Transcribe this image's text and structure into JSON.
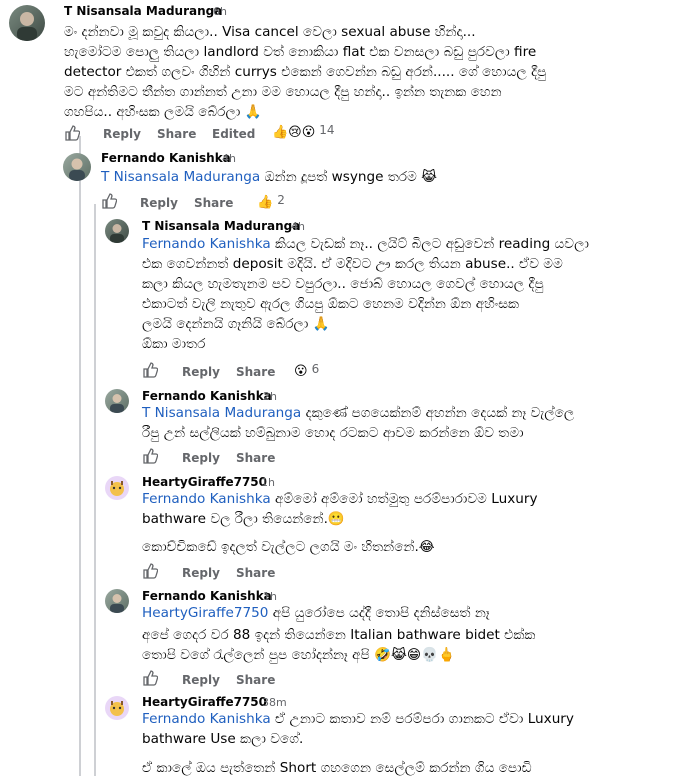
{
  "actions": {
    "reply": "Reply",
    "share": "Share",
    "edited": "Edited"
  },
  "comments": [
    {
      "author": "T Nisansala Maduranga",
      "time": "6h",
      "lines": [
        "මං දන්නවා මූ කවුද කියලා.. Visa cancel වෙලා sexual abuse හින්දා...",
        "හැමෝටම පොලු තියලා landlord වත් නොකියා flat එක වනසලා බඩු පුරවලා fire",
        "detector එකත් ගලවං ගිහින් currys එකෙන් ගෙවන්න බඩු අරන්..... ගේ හොයල දීපු",
        "මට අන්තිමට තීන්ත ගාන්නත් උනා මම හොයල දීපු හන්දා.. ඉන්න තැනක හෙන",
        "ගහපිය.. අහිංසක ලමයි බේරලා 🙏"
      ],
      "reactions": {
        "icons": "👍😢😮",
        "count": "14"
      }
    },
    {
      "author": "Fernando Kanishka",
      "time": "4h",
      "mention": "T Nisansala Maduranga",
      "lines": [
        "ඔන්න දූපත් wsynge තරම 😹"
      ],
      "reactions": {
        "icons": "👍",
        "count": "2"
      }
    },
    {
      "author": "T Nisansala Maduranga",
      "time": "4h",
      "mention": "Fernando Kanishka",
      "lines": [
        "කියල වැඩක් නෑ.. ලයිට් බිලට අඩුවෙන් reading යවලා",
        "එක ගෙවන්නත් deposit මදියි. ඒ මදිවට ඌ කරල තියන abuse.. ඒව මම",
        "කලා කියල හැමතැනම පව වපුරලා.. ජොබ් හොයල ගෙවල් හොයල දීපු",
        "එකාටත් වැලි නැතුව ඇරල ගියපු ඕකට හෙනම වදින්න ඕන අහිංසක",
        "ලමයි දෙන්නයි ගෑනියි බේරලා 🙏",
        "ඕකා මාතර"
      ],
      "reactions": {
        "icons": "😮",
        "count": "6"
      }
    },
    {
      "author": "Fernando Kanishka",
      "time": "2h",
      "mention": "T Nisansala Maduranga",
      "lines": [
        "දකුණේ පගයෙක්නම් අහන්න දෙයක් නෑ වැල්ලෙ",
        "රීපු උන් සල්ලියක් හම්බුනාම හොද රටකට ආවම කරන්නෙ ඕව තමා"
      ]
    },
    {
      "author": "HeartyGiraffe7750",
      "time": "1h",
      "mention": "Fernando Kanishka",
      "lines": [
        "අම්මෝ අම්මෝ හත්මුතු පරම්පාරාවම Luxury",
        "bathware වල රීලා තියෙන්නේ.😬",
        "",
        "කොච්චිකඩේ ඉදලත් වැල්ලට ලගයි මං හිතන්නේ.😂"
      ]
    },
    {
      "author": "Fernando Kanishka",
      "time": "1h",
      "mention": "HeartyGiraffe7750",
      "lines": [
        "අපි යුරෝපෙ යද්දී තොපි දනිස්සෙත් නෑ",
        "අපේ ගෙදර වර 88 ඉදන් තියෙන්නෙ Italian bathware bidet එක්ක",
        "තොපි වගේ රැල්ලෙන් පුප හෝදන්නෑ අපි 🤣😹😁💀🖕"
      ]
    },
    {
      "author": "HeartyGiraffe7750",
      "time": "38m",
      "mention": "Fernando Kanishka",
      "lines": [
        "ඒ උනාට කතාව නම් පරම්පරා ගානකට ඒවා Luxury",
        "bathware Use කලා වගේ.",
        "",
        "ඒ කාලේ ඔය පැත්තෙන් Short ගහගෙන සෙල්ලම් කරන්න ගිය පොඩි"
      ]
    }
  ]
}
